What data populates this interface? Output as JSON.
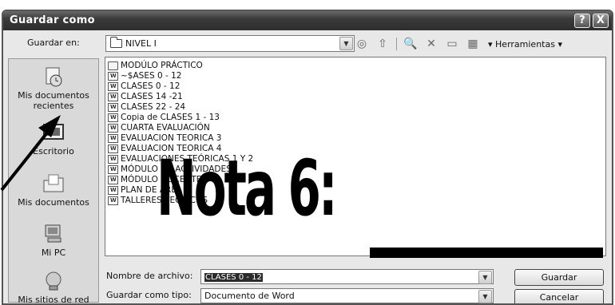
{
  "window": {
    "title": "Guardar como",
    "help_label": "?",
    "close_label": "X"
  },
  "save_in": {
    "label": "Guardar en:",
    "value": "NIVEL I",
    "tools_label": "Herramientas"
  },
  "places": [
    {
      "label": "Mis documentos recientes",
      "icon": "recent-documents-icon"
    },
    {
      "label": "Escritorio",
      "icon": "desktop-icon"
    },
    {
      "label": "Mis documentos",
      "icon": "my-documents-icon"
    },
    {
      "label": "Mi PC",
      "icon": "my-computer-icon"
    },
    {
      "label": "Mis sitios de red",
      "icon": "network-places-icon"
    }
  ],
  "files": [
    {
      "name": "MODÚLO PRÁCTICO",
      "type": "folder"
    },
    {
      "name": "~$ASES 0 - 12",
      "type": "doc"
    },
    {
      "name": "CLASES 0 - 12",
      "type": "doc"
    },
    {
      "name": "CLASES 14 -21",
      "type": "doc"
    },
    {
      "name": "CLASES 22 - 24",
      "type": "doc"
    },
    {
      "name": "Copia de CLASES 1 - 13",
      "type": "doc"
    },
    {
      "name": "CUARTA EVALUACIÓN",
      "type": "doc"
    },
    {
      "name": "EVALUACION TEORICA 3",
      "type": "doc"
    },
    {
      "name": "EVALUACION TEORICA 4",
      "type": "doc"
    },
    {
      "name": "EVALUACIONES TEÓRICAS 1 Y 2",
      "type": "doc"
    },
    {
      "name": "MÓDULO DE ACTIVIDADES",
      "type": "doc"
    },
    {
      "name": "MÓDULO DOCENTE",
      "type": "doc"
    },
    {
      "name": "PLAN DE ÁREA",
      "type": "doc"
    },
    {
      "name": "TALLERES TEÓRICOS",
      "type": "doc"
    }
  ],
  "filename": {
    "label": "Nombre de archivo:",
    "value": "CLASES 0 - 12"
  },
  "filetype": {
    "label": "Guardar como tipo:",
    "value": "Documento de Word"
  },
  "buttons": {
    "save": "Guardar",
    "cancel": "Cancelar"
  },
  "overlay": {
    "text": "Nota 6:"
  }
}
